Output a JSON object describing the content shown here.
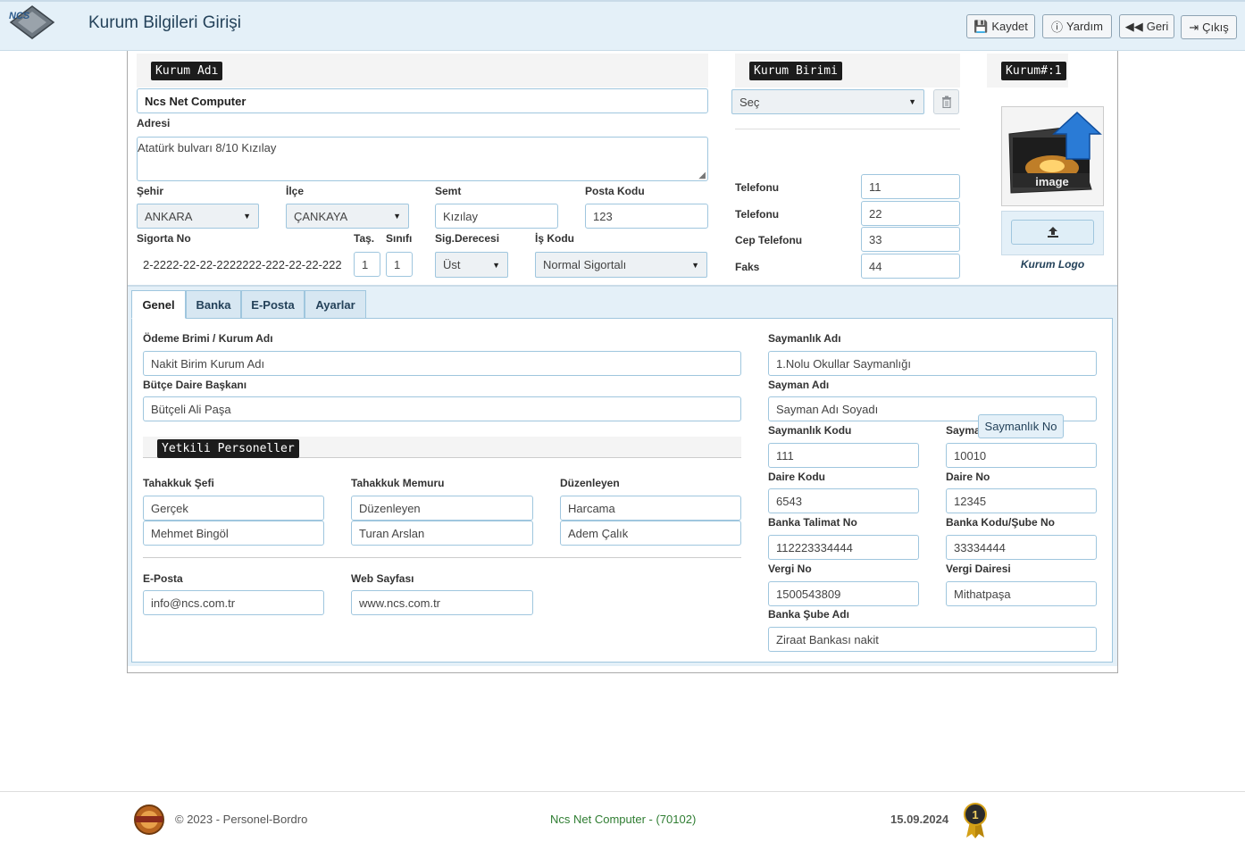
{
  "header": {
    "title": "Kurum Bilgileri Girişi",
    "logo_text": "NCS",
    "buttons": {
      "save": "Kaydet",
      "help": "Yardım",
      "back": "Geri",
      "exit": "Çıkış"
    }
  },
  "institution": {
    "name_header": "Kurum Adı",
    "name_value": "Ncs Net Computer",
    "address_label": "Adresi",
    "address_value": "Atatürk bulvarı 8/10 Kızılay",
    "city_label": "Şehir",
    "city_value": "ANKARA",
    "district_label": "İlçe",
    "district_value": "ÇANKAYA",
    "neighborhood_label": "Semt",
    "neighborhood_value": "Kızılay",
    "postal_label": "Posta Kodu",
    "postal_value": "123",
    "insurance_label": "Sigorta No",
    "insurance_value": "2-2222-22-22-2222222-222-22-22-222",
    "tas_label": "Taş.",
    "tas_value": "1",
    "class_label": "Sınıfı",
    "class_value": "1",
    "degree_label": "Sig.Derecesi",
    "degree_value": "Üst",
    "job_code_label": "İş Kodu",
    "job_code_value": "Normal Sigortalı"
  },
  "unit": {
    "header": "Kurum Birimi",
    "select_value": "Seç",
    "phone1_label": "Telefonu",
    "phone1_value": "11",
    "phone2_label": "Telefonu",
    "phone2_value": "22",
    "mobile_label": "Cep Telefonu",
    "mobile_value": "33",
    "fax_label": "Faks",
    "fax_value": "44"
  },
  "logo_panel": {
    "id_label": "Kurum#:1",
    "image_text": "image",
    "caption": "Kurum Logo"
  },
  "tabs": [
    "Genel",
    "Banka",
    "E-Posta",
    "Ayarlar"
  ],
  "general": {
    "payment_unit_label": "Ödeme Brimi / Kurum Adı",
    "payment_unit_value": "Nakit Birim Kurum Adı",
    "budget_head_label": "Bütçe Daire Başkanı",
    "budget_head_value": "Bütçeli Ali Paşa",
    "authorized_header": "Yetkili Personeller",
    "accrual_chief_label": "Tahakkuk Şefi",
    "accrual_chief_values": [
      "Gerçek",
      "Mehmet Bingöl"
    ],
    "accrual_officer_label": "Tahakkuk Memuru",
    "accrual_officer_values": [
      "Düzenleyen",
      "Turan Arslan"
    ],
    "editor_label": "Düzenleyen",
    "editor_values": [
      "Harcama",
      "Adem Çalık"
    ],
    "email_label": "E-Posta",
    "email_value": "info@ncs.com.tr",
    "web_label": "Web Sayfası",
    "web_value": "www.ncs.com.tr"
  },
  "accounting": {
    "office_name_label": "Saymanlık Adı",
    "office_name_value": "1.Nolu Okullar Saymanlığı",
    "accountant_label": "Sayman Adı",
    "accountant_value": "Sayman Adı Soyadı",
    "office_code_label": "Saymanlık Kodu",
    "office_code_value": "111",
    "office_no_label": "Sayma",
    "office_no_value": "10010",
    "office_no_tooltip": "Saymanlık No",
    "dept_code_label": "Daire Kodu",
    "dept_code_value": "6543",
    "dept_no_label": "Daire No",
    "dept_no_value": "12345",
    "bank_order_label": "Banka Talimat No",
    "bank_order_value": "112223334444",
    "bank_code_label": "Banka Kodu/Şube No",
    "bank_code_value": "33334444",
    "tax_no_label": "Vergi No",
    "tax_no_value": "1500543809",
    "tax_office_label": "Vergi Dairesi",
    "tax_office_value": "Mithatpaşa",
    "bank_branch_label": "Banka Şube Adı",
    "bank_branch_value": "Ziraat Bankası nakit"
  },
  "footer": {
    "copyright": "© 2023 - Personel-Bordro",
    "company": "Ncs Net Computer - (70102)",
    "date": "15.09.2024",
    "badge_text": "1"
  },
  "colors": {
    "accent": "#24425a",
    "panel": "#e4f0f8",
    "border": "#9fc6de",
    "footer_company": "#2f7d32"
  }
}
